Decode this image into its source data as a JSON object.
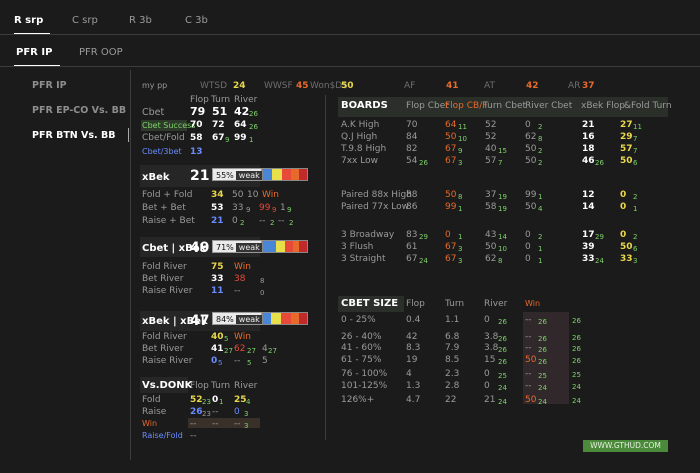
{
  "top_tabs": [
    "R srp",
    "C srp",
    "R 3b",
    "C 3b"
  ],
  "sub_tabs": [
    "PFR IP",
    "PFR OOP"
  ],
  "sidebar": [
    "PFR IP",
    "PFR EP-CO Vs. BB",
    "PFR BTN Vs. BB"
  ],
  "header": {
    "player": "my pp",
    "wtsd_label": "WTSD",
    "wtsd": "24",
    "wwsf_label": "WWSF",
    "wwsf": "45",
    "won_label": "Won$D$",
    "won": "50",
    "af_label": "AF",
    "af": "41",
    "at_label": "AT",
    "at": "42",
    "ar_label": "AR",
    "ar": "37"
  },
  "cbet": {
    "cols": [
      "Flop",
      "Turn",
      "River"
    ],
    "rows": [
      {
        "label": "Cbet",
        "flop": "79",
        "turn": "51",
        "river": "42",
        "river_sub": "26"
      },
      {
        "label": "Cbet Success",
        "flop": "70",
        "turn": "72",
        "river": "64",
        "river_sub": "26"
      },
      {
        "label": "Cbet/Fold",
        "flop": "58",
        "turn": "67",
        "turn_sub": "9",
        "river": "99",
        "river_sub": "1"
      }
    ],
    "cbet3bet": "Cbet/3bet",
    "cbet3bet_val": "13"
  },
  "xbek": {
    "title": "xBek",
    "value": "21",
    "badge": "55%",
    "badge_txt": "weak",
    "rows": [
      {
        "label": "Fold + Fold",
        "a": "34",
        "a_sub": "50",
        "b": "10",
        "c": "Win"
      },
      {
        "label": "Bet + Bet",
        "a": "53",
        "a_sub": "33",
        "a_sub2": "9",
        "b": "99",
        "b_sub": "9",
        "c": "1",
        "c_sub": "9"
      },
      {
        "label": "Raise + Bet",
        "a": "21",
        "b": "0",
        "b_sub": "2",
        "c": "--",
        "c_sub": "2",
        "d": "--",
        "d_sub": "2"
      }
    ]
  },
  "cbet_xbek": {
    "title": "Cbet | xBek",
    "value": "49",
    "badge": "71%",
    "badge_txt": "weak",
    "rows": [
      {
        "label": "Fold River",
        "a": "75",
        "b": "Win"
      },
      {
        "label": "Bet River",
        "a": "33",
        "b": "38",
        "c": "8"
      },
      {
        "label": "Raise River",
        "a": "11",
        "b": "--",
        "c": "0"
      }
    ]
  },
  "xbek_xbek": {
    "title": "xBek | xBek",
    "value": "47",
    "badge": "84%",
    "badge_txt": "weak",
    "rows": [
      {
        "label": "Fold River",
        "a": "40",
        "a_sub": "5",
        "b": "Win"
      },
      {
        "label": "Bet River",
        "a": "41",
        "a_sub": "27",
        "b": "62",
        "b_sub": "27",
        "c": "4",
        "c_sub": "27"
      },
      {
        "label": "Raise River",
        "a": "0",
        "a_sub": "5",
        "b": "--",
        "b_sub": "5",
        "c": "5"
      }
    ]
  },
  "donk": {
    "title": "Vs.DONK",
    "cols": [
      "Flop",
      "Turn",
      "River"
    ],
    "rows": [
      {
        "label": "Fold",
        "flop": "52",
        "flop_sub": "23",
        "turn": "0",
        "turn_sub": "1",
        "river": "25",
        "river_sub": "4"
      },
      {
        "label": "Raise",
        "flop": "26",
        "flop_sub": "23",
        "turn": "--",
        "river": "0",
        "river_sub": "3"
      },
      {
        "label": "Win",
        "flop": "--",
        "turn": "--",
        "river": "--",
        "river_sub": "3"
      },
      {
        "label": "Raise/Fold",
        "flop": "--"
      }
    ]
  },
  "boards": {
    "title": "BOARDS",
    "cols": [
      "Flop Cbet",
      "Flop CB/F",
      "Turn Cbet",
      "River Cbet",
      "xBek Flop",
      "&Fold Turn"
    ],
    "groups": [
      [
        {
          "label": "A.K High",
          "c1": "70",
          "c2": "64",
          "c2s": "11",
          "c3": "52",
          "c4": "0",
          "c4s": "2",
          "c5": "21",
          "c6": "27",
          "c6s": "11"
        },
        {
          "label": "Q.J High",
          "c1": "84",
          "c2": "50",
          "c2s": "10",
          "c3": "52",
          "c4": "62",
          "c4s": "8",
          "c5": "16",
          "c6": "29",
          "c6s": "7"
        },
        {
          "label": "T.9.8 High",
          "c1": "82",
          "c2": "67",
          "c2s": "9",
          "c3": "40",
          "c3s": "15",
          "c4": "50",
          "c4s": "2",
          "c5": "18",
          "c6": "57",
          "c6s": "7"
        },
        {
          "label": "7xx Low",
          "c1": "54",
          "c1s": "26",
          "c2": "67",
          "c2s": "3",
          "c3": "57",
          "c3s": "7",
          "c4": "50",
          "c4s": "2",
          "c5": "46",
          "c5s": "26",
          "c6": "50",
          "c6s": "6"
        }
      ],
      [
        {
          "label": "Paired 88x High",
          "c1": "88",
          "c2": "50",
          "c2s": "8",
          "c3": "37",
          "c3s": "19",
          "c4": "99",
          "c4s": "1",
          "c5": "12",
          "c6": "0",
          "c6s": "2"
        },
        {
          "label": "Paired 77x Low",
          "c1": "86",
          "c2": "99",
          "c2s": "1",
          "c3": "58",
          "c3s": "19",
          "c4": "50",
          "c4s": "4",
          "c5": "14",
          "c6": "0",
          "c6s": "1"
        }
      ],
      [
        {
          "label": "3 Broadway",
          "c1": "83",
          "c1s": "29",
          "c2": "0",
          "c2s": "1",
          "c3": "43",
          "c3s": "14",
          "c4": "0",
          "c4s": "2",
          "c5": "17",
          "c5s": "29",
          "c6": "0",
          "c6s": "2"
        },
        {
          "label": "3 Flush",
          "c1": "61",
          "c2": "67",
          "c2s": "3",
          "c3": "50",
          "c3s": "10",
          "c4": "0",
          "c4s": "1",
          "c5": "39",
          "c6": "50",
          "c6s": "6"
        },
        {
          "label": "3 Straight",
          "c1": "67",
          "c1s": "24",
          "c2": "67",
          "c2s": "3",
          "c3": "62",
          "c3s": "8",
          "c4": "0",
          "c4s": "1",
          "c5": "33",
          "c5s": "24",
          "c6": "33",
          "c6s": "3"
        }
      ]
    ]
  },
  "cbet_size": {
    "title": "CBET SIZE",
    "cols": [
      "Flop",
      "Turn",
      "River",
      "Win"
    ],
    "rows": [
      {
        "label": "0 - 25%",
        "flop": "0.4",
        "turn": "1.1",
        "river": "0",
        "river_s": "26",
        "win": "--",
        "win_s": "26",
        "x": "26"
      },
      {
        "label": "26 - 40%",
        "flop": "42",
        "turn": "6.8",
        "river": "3.8",
        "river_s": "26",
        "win": "--",
        "win_s": "26",
        "x": "26"
      },
      {
        "label": "41 - 60%",
        "flop": "8.3",
        "turn": "7.9",
        "river": "3.8",
        "river_s": "26",
        "win": "--",
        "win_s": "26",
        "x": "26"
      },
      {
        "label": "61 - 75%",
        "flop": "19",
        "turn": "8.5",
        "river": "15",
        "river_s": "26",
        "win": "50",
        "win_s": "26",
        "x": "26"
      },
      {
        "label": "76 - 100%",
        "flop": "4",
        "turn": "2.3",
        "river": "0",
        "river_s": "25",
        "win": "--",
        "win_s": "25",
        "x": "25"
      },
      {
        "label": "101-125%",
        "flop": "1.3",
        "turn": "2.8",
        "river": "0",
        "river_s": "24",
        "win": "--",
        "win_s": "24",
        "x": "24"
      },
      {
        "label": "126%+",
        "flop": "4.7",
        "turn": "22",
        "river": "21",
        "river_s": "24",
        "win": "50",
        "win_s": "24",
        "x": "24"
      }
    ]
  },
  "footer": "WWW.GTHUD.COM"
}
